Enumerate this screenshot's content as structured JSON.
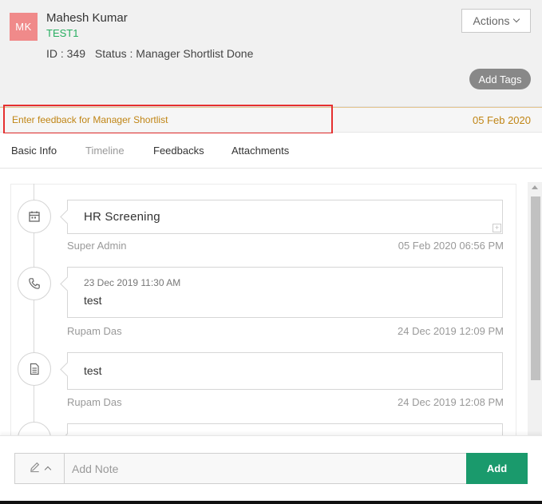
{
  "candidate": {
    "initials": "MK",
    "name": "Mahesh Kumar",
    "code": "TEST1",
    "id_text": "ID : 349",
    "status_text": "Status : Manager Shortlist Done"
  },
  "header_actions": {
    "actions_label": "Actions",
    "add_tags_label": "Add Tags"
  },
  "feedback_bar": {
    "link_text": "Enter feedback for Manager Shortlist",
    "date": "05 Feb 2020",
    "highlight_color": "#e53030"
  },
  "tabs": [
    {
      "label": "Basic Info"
    },
    {
      "label": "Timeline"
    },
    {
      "label": "Feedbacks"
    },
    {
      "label": "Attachments"
    }
  ],
  "timeline": [
    {
      "icon": "calendar-icon",
      "title": "HR Screening",
      "by": "Super Admin",
      "when": "05 Feb 2020 06:56 PM"
    },
    {
      "icon": "phone-icon",
      "subtitle": "23 Dec 2019 11:30 AM",
      "text": "test",
      "by": "Rupam Das",
      "when": "24 Dec 2019 12:09 PM"
    },
    {
      "icon": "document-icon",
      "text": "test",
      "by": "Rupam Das",
      "when": "24 Dec 2019 12:08 PM"
    }
  ],
  "note": {
    "placeholder": "Add Note",
    "add_label": "Add",
    "tool_icon": "pencil-icon"
  },
  "colors": {
    "accent_green": "#1a9a6c",
    "avatar_bg": "#f08a8a",
    "feedback_text": "#c08515",
    "code_green": "#27ae60"
  }
}
